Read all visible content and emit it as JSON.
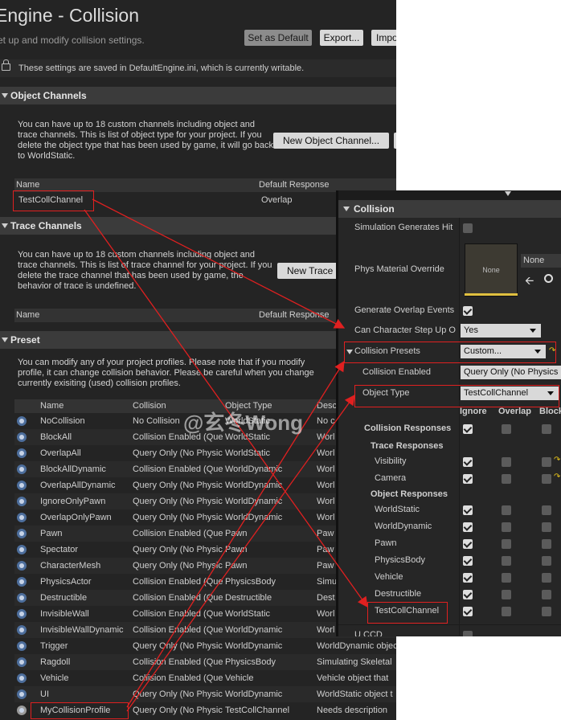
{
  "header": {
    "title": "Engine - Collision",
    "subtitle": "et up and modify collision settings.",
    "btn_default": "Set as Default",
    "btn_export": "Export...",
    "btn_import": "Impo"
  },
  "info_text": "These settings are saved in DefaultEngine.ini, which is currently writable.",
  "object_channels": {
    "title": "Object Channels",
    "desc": "You can have up to 18 custom channels including object and trace channels. This is list of object type for your project. If you delete the object type that has been used by game, it will go back to WorldStatic.",
    "new_button": "New Object Channel...",
    "col_name": "Name",
    "col_response": "Default Response",
    "row_name": "TestCollChannel",
    "row_response": "Overlap"
  },
  "trace_channels": {
    "title": "Trace Channels",
    "desc": "You can have up to 18 custom channels including object and trace channels. This is list of trace channel for your project. If you delete the trace channel that has been used by game, the behavior of trace is undefined.",
    "new_button": "New Trace",
    "col_name": "Name",
    "col_response": "Default Response"
  },
  "preset": {
    "title": "Preset",
    "desc": "You can modify any of your project profiles. Please note that if you modify profile, it can change collision behavior. Please be careful when you change currently exisiting (used) collision profiles.",
    "col_name": "Name",
    "col_collision": "Collision",
    "col_object": "Object Type",
    "col_desc": "Desc",
    "rows": [
      {
        "name": "NoCollision",
        "collision": "No Collision",
        "object": "WorldStatic",
        "desc": "No c"
      },
      {
        "name": "BlockAll",
        "collision": "Collision Enabled (Quei",
        "object": "WorldStatic",
        "desc": "Worl"
      },
      {
        "name": "OverlapAll",
        "collision": "Query Only (No Physic",
        "object": "WorldStatic",
        "desc": "Worl"
      },
      {
        "name": "BlockAllDynamic",
        "collision": "Collision Enabled (Quei",
        "object": "WorldDynamic",
        "desc": "Worl"
      },
      {
        "name": "OverlapAllDynamic",
        "collision": "Query Only (No Physic",
        "object": "WorldDynamic",
        "desc": "Worl"
      },
      {
        "name": "IgnoreOnlyPawn",
        "collision": "Query Only (No Physic",
        "object": "WorldDynamic",
        "desc": "Worl"
      },
      {
        "name": "OverlapOnlyPawn",
        "collision": "Query Only (No Physic",
        "object": "WorldDynamic",
        "desc": "Worl"
      },
      {
        "name": "Pawn",
        "collision": "Collision Enabled (Quei",
        "object": "Pawn",
        "desc": "Paw"
      },
      {
        "name": "Spectator",
        "collision": "Query Only (No Physic",
        "object": "Pawn",
        "desc": "Paw"
      },
      {
        "name": "CharacterMesh",
        "collision": "Query Only (No Physic",
        "object": "Pawn",
        "desc": "Paw"
      },
      {
        "name": "PhysicsActor",
        "collision": "Collision Enabled (Quei",
        "object": "PhysicsBody",
        "desc": "Simu"
      },
      {
        "name": "Destructible",
        "collision": "Collision Enabled (Quei",
        "object": "Destructible",
        "desc": "Dest"
      },
      {
        "name": "InvisibleWall",
        "collision": "Collision Enabled (Quei",
        "object": "WorldStatic",
        "desc": "Worl"
      },
      {
        "name": "InvisibleWallDynamic",
        "collision": "Collision Enabled (Quei",
        "object": "WorldDynamic",
        "desc": "Worl"
      },
      {
        "name": "Trigger",
        "collision": "Query Only (No Physic",
        "object": "WorldDynamic",
        "desc": "WorldDynamic objec"
      },
      {
        "name": "Ragdoll",
        "collision": "Collision Enabled (Quei",
        "object": "PhysicsBody",
        "desc": "Simulating Skeletal"
      },
      {
        "name": "Vehicle",
        "collision": "Collision Enabled (Quei",
        "object": "Vehicle",
        "desc": "Vehicle object that"
      },
      {
        "name": "UI",
        "collision": "Query Only (No Physic",
        "object": "WorldDynamic",
        "desc": "WorldStatic object t"
      },
      {
        "name": "MyCollisionProfile",
        "collision": "Query Only (No Physic",
        "object": "TestCollChannel",
        "desc": "Needs description"
      }
    ]
  },
  "details": {
    "section": "Collision",
    "sim_hit": "Simulation Generates Hit",
    "phys_mat": "Phys Material Override",
    "phys_none_thumb": "None",
    "phys_none": "None",
    "overlap_events": "Generate Overlap Events",
    "step_up": "Can Character Step Up O",
    "step_up_value": "Yes",
    "presets_label": "Collision Presets",
    "presets_value": "Custom...",
    "enabled_label": "Collision Enabled",
    "enabled_value": "Query Only (No Physics",
    "object_type_label": "Object Type",
    "object_type_value": "TestCollChannel",
    "col_ignore": "Ignore",
    "col_overlap": "Overlap",
    "col_block": "Block",
    "responses_label": "Collision Responses",
    "trace_label": "Trace Responses",
    "visibility": "Visibility",
    "camera": "Camera",
    "object_label": "Object Responses",
    "obj_rows": [
      "WorldStatic",
      "WorldDynamic",
      "Pawn",
      "PhysicsBody",
      "Vehicle",
      "Destructible",
      "TestCollChannel"
    ],
    "bottom_cut": "U    CCD"
  },
  "watermark": "@玄冬Wong",
  "colors": {
    "annotation": "#e02020",
    "panel_bg": "#242424",
    "highlight": "#e6c21a"
  }
}
